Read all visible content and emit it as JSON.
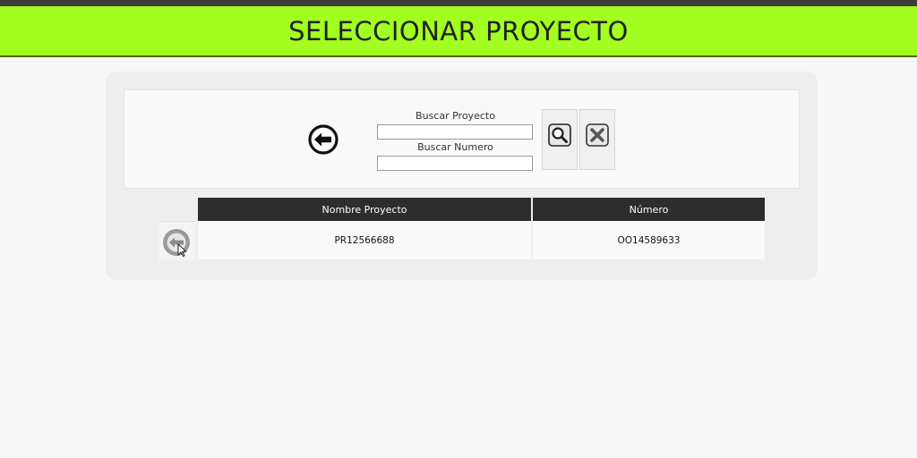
{
  "header": {
    "title": "SELECCIONAR PROYECTO"
  },
  "search": {
    "project_label": "Buscar Proyecto",
    "project_value": "",
    "number_label": "Buscar Numero",
    "number_value": ""
  },
  "icons": {
    "back": "back-arrow-circle-icon",
    "search": "magnifier-icon",
    "clear": "close-x-icon",
    "select": "select-arrow-circle-icon"
  },
  "colors": {
    "header_bg": "#a2ff1f",
    "table_header_bg": "#2d2d2d"
  },
  "table": {
    "columns": [
      "Nombre Proyecto",
      "Número"
    ],
    "rows": [
      {
        "name": "PR12566688",
        "number": "OO14589633"
      }
    ]
  }
}
